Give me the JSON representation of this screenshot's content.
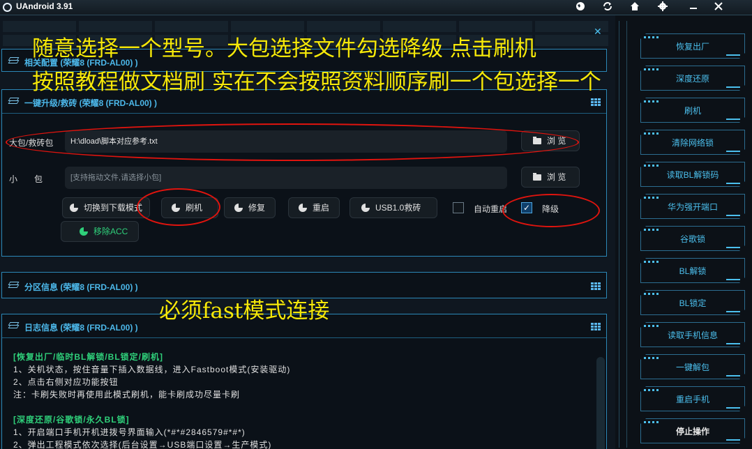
{
  "titlebar": {
    "title": "UAndroid 3.91",
    "icons": [
      "globe-icon",
      "refresh-icon",
      "home-icon",
      "gear-icon",
      "minimize-icon",
      "close-icon"
    ]
  },
  "panels": {
    "related": {
      "title": "相关配置 (荣耀8 (FRD-AL00) )"
    },
    "upgrade": {
      "title": "一键升级/救砖 (荣耀8 (FRD-AL00) )"
    },
    "partition": {
      "title": "分区信息 (荣耀8 (FRD-AL00) )"
    },
    "log": {
      "title": "日志信息 (荣耀8 (FRD-AL00) )"
    }
  },
  "form": {
    "big_label": "大包/救砖包",
    "big_value": "H:\\dload\\脚本对应参考.txt",
    "small_label": "小　　包",
    "small_placeholder": "[支持拖动文件,请选择小包]",
    "browse": "浏 览"
  },
  "actions": {
    "download_mode": "切换到下载模式",
    "flash": "刷机",
    "repair": "修复",
    "reboot": "重启",
    "usb_rescue": "USB1.0救砖",
    "auto_reboot": "自动重启",
    "auto_reboot_checked": false,
    "downgrade": "降级",
    "downgrade_checked": true,
    "remove_acc": "移除ACC"
  },
  "log_lines": [
    {
      "text": "[恢复出厂/临时BL解锁/BL锁定/刷机]",
      "header": true
    },
    {
      "text": "1、关机状态，按住音量下插入数据线，进入Fastboot模式(安装驱动)",
      "header": false
    },
    {
      "text": "2、点击右侧对应功能按钮",
      "header": false
    },
    {
      "text": "注：卡刷失败时再使用此模式刷机，能卡刷成功尽量卡刷",
      "header": false
    },
    {
      "text": "",
      "header": false
    },
    {
      "text": "[深度还原/谷歌锁/永久BL锁]",
      "header": true
    },
    {
      "text": "1、开启端口手机开机进拨号界面输入(*#*#2846579#*#*)",
      "header": false
    },
    {
      "text": "2、弹出工程模式依次选择(后台设置→USB端口设置→生产模式)",
      "header": false
    }
  ],
  "sidebar": [
    "恢复出厂",
    "深度还原",
    "刷机",
    "清除网络锁",
    "读取BL解锁码",
    "华为强开端口",
    "谷歌锁",
    "BL解锁",
    "BL锁定",
    "读取手机信息",
    "一键解包",
    "重启手机",
    "停止操作"
  ],
  "overlay": {
    "line1": "随意选择一个型号。大包选择文件勾选降级 点击刷机",
    "line2": "按照教程做文档刷 实在不会按照资料顺序刷一个包选择一个",
    "line3": "必须fast模式连接"
  },
  "colors": {
    "accent": "#4cb8ea",
    "overlay_text": "#f5e80a",
    "annotation": "#e0140e",
    "log_header": "#2fd07a"
  }
}
